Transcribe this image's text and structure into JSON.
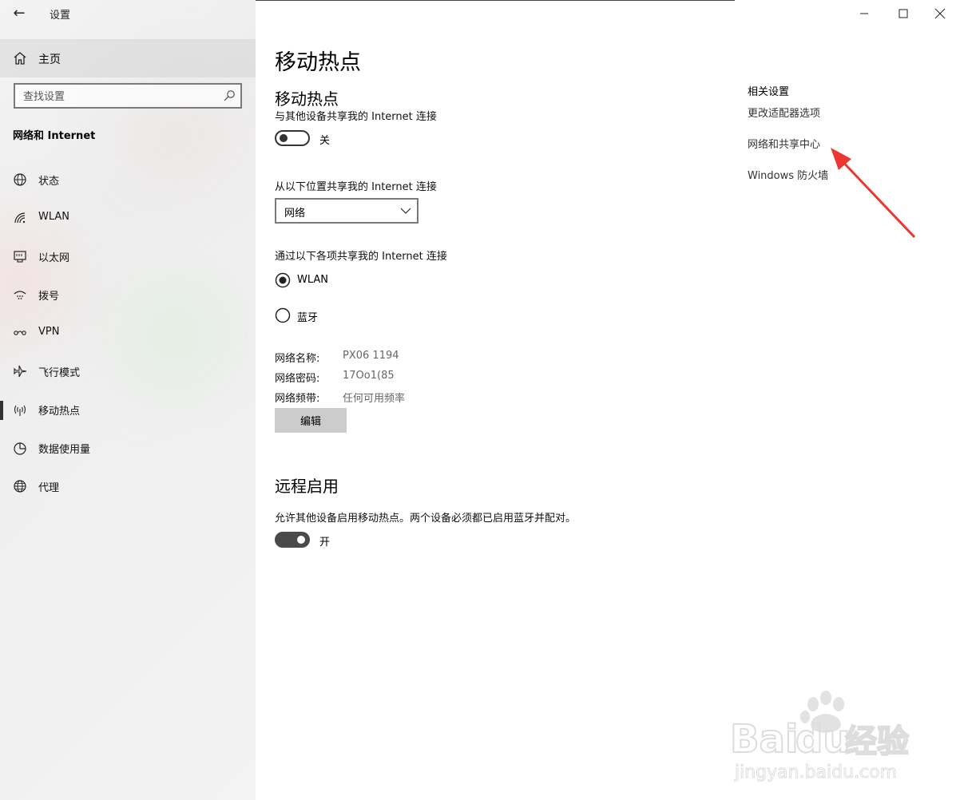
{
  "window": {
    "title": "设置",
    "back_label": "←"
  },
  "sidebar": {
    "home_label": "主页",
    "search_placeholder": "查找设置",
    "section_title": "网络和 Internet",
    "items": [
      {
        "label": "状态",
        "icon": "globe-status-icon"
      },
      {
        "label": "WLAN",
        "icon": "wifi-icon"
      },
      {
        "label": "以太网",
        "icon": "ethernet-icon"
      },
      {
        "label": "拨号",
        "icon": "dialup-icon"
      },
      {
        "label": "VPN",
        "icon": "vpn-icon"
      },
      {
        "label": "飞行模式",
        "icon": "airplane-icon"
      },
      {
        "label": "移动热点",
        "icon": "hotspot-icon",
        "selected": true
      },
      {
        "label": "数据使用量",
        "icon": "data-usage-icon"
      },
      {
        "label": "代理",
        "icon": "proxy-globe-icon"
      }
    ]
  },
  "main": {
    "page_title": "移动热点",
    "hotspot": {
      "heading": "移动热点",
      "share_desc": "与其他设备共享我的 Internet 连接",
      "toggle_state": "关",
      "toggle_on": false,
      "share_from_label": "从以下位置共享我的 Internet 连接",
      "share_from_value": "网络",
      "share_over_label": "通过以下各项共享我的 Internet 连接",
      "options": [
        {
          "label": "WLAN",
          "selected": true
        },
        {
          "label": "蓝牙",
          "selected": false
        }
      ],
      "network_name_label": "网络名称:",
      "network_name_value": "PX06 1194",
      "network_password_label": "网络密码:",
      "network_password_value": "17Oo1(85",
      "network_band_label": "网络频带:",
      "network_band_value": "任何可用频率",
      "edit_label": "编辑"
    },
    "remote": {
      "heading": "远程启用",
      "desc": "允许其他设备启用移动热点。两个设备必须都已启用蓝牙并配对。",
      "toggle_state": "开",
      "toggle_on": true
    },
    "related": {
      "title": "相关设置",
      "links": [
        "更改适配器选项",
        "网络和共享中心",
        "Windows 防火墙"
      ]
    }
  },
  "watermark": {
    "brand_a": "Bai",
    "brand_b": "du",
    "brand_cn": "经验",
    "url": "jingyan.baidu.com"
  },
  "colors": {
    "annotation_arrow": "#e8382f",
    "sidebar_bg": "#f0f0f0",
    "button_bg": "#cccccc"
  }
}
